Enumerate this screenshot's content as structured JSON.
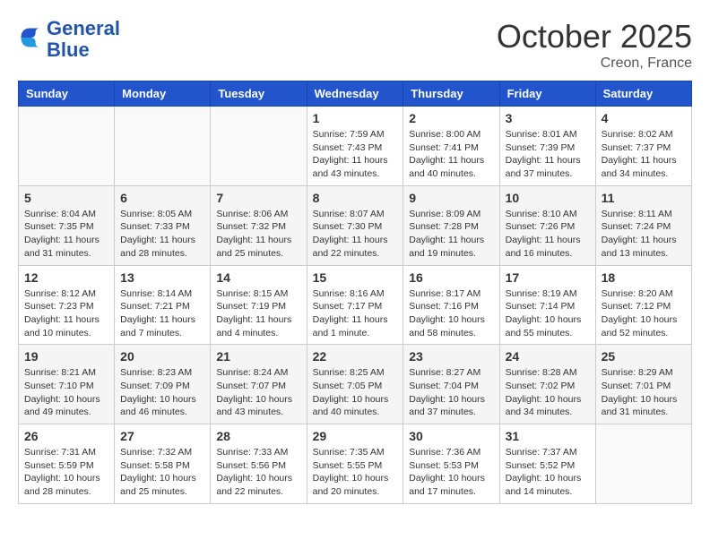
{
  "header": {
    "logo_line1": "General",
    "logo_line2": "Blue",
    "month": "October 2025",
    "location": "Creon, France"
  },
  "weekdays": [
    "Sunday",
    "Monday",
    "Tuesday",
    "Wednesday",
    "Thursday",
    "Friday",
    "Saturday"
  ],
  "weeks": [
    [
      {
        "day": "",
        "sunrise": "",
        "sunset": "",
        "daylight": ""
      },
      {
        "day": "",
        "sunrise": "",
        "sunset": "",
        "daylight": ""
      },
      {
        "day": "",
        "sunrise": "",
        "sunset": "",
        "daylight": ""
      },
      {
        "day": "1",
        "sunrise": "Sunrise: 7:59 AM",
        "sunset": "Sunset: 7:43 PM",
        "daylight": "Daylight: 11 hours and 43 minutes."
      },
      {
        "day": "2",
        "sunrise": "Sunrise: 8:00 AM",
        "sunset": "Sunset: 7:41 PM",
        "daylight": "Daylight: 11 hours and 40 minutes."
      },
      {
        "day": "3",
        "sunrise": "Sunrise: 8:01 AM",
        "sunset": "Sunset: 7:39 PM",
        "daylight": "Daylight: 11 hours and 37 minutes."
      },
      {
        "day": "4",
        "sunrise": "Sunrise: 8:02 AM",
        "sunset": "Sunset: 7:37 PM",
        "daylight": "Daylight: 11 hours and 34 minutes."
      }
    ],
    [
      {
        "day": "5",
        "sunrise": "Sunrise: 8:04 AM",
        "sunset": "Sunset: 7:35 PM",
        "daylight": "Daylight: 11 hours and 31 minutes."
      },
      {
        "day": "6",
        "sunrise": "Sunrise: 8:05 AM",
        "sunset": "Sunset: 7:33 PM",
        "daylight": "Daylight: 11 hours and 28 minutes."
      },
      {
        "day": "7",
        "sunrise": "Sunrise: 8:06 AM",
        "sunset": "Sunset: 7:32 PM",
        "daylight": "Daylight: 11 hours and 25 minutes."
      },
      {
        "day": "8",
        "sunrise": "Sunrise: 8:07 AM",
        "sunset": "Sunset: 7:30 PM",
        "daylight": "Daylight: 11 hours and 22 minutes."
      },
      {
        "day": "9",
        "sunrise": "Sunrise: 8:09 AM",
        "sunset": "Sunset: 7:28 PM",
        "daylight": "Daylight: 11 hours and 19 minutes."
      },
      {
        "day": "10",
        "sunrise": "Sunrise: 8:10 AM",
        "sunset": "Sunset: 7:26 PM",
        "daylight": "Daylight: 11 hours and 16 minutes."
      },
      {
        "day": "11",
        "sunrise": "Sunrise: 8:11 AM",
        "sunset": "Sunset: 7:24 PM",
        "daylight": "Daylight: 11 hours and 13 minutes."
      }
    ],
    [
      {
        "day": "12",
        "sunrise": "Sunrise: 8:12 AM",
        "sunset": "Sunset: 7:23 PM",
        "daylight": "Daylight: 11 hours and 10 minutes."
      },
      {
        "day": "13",
        "sunrise": "Sunrise: 8:14 AM",
        "sunset": "Sunset: 7:21 PM",
        "daylight": "Daylight: 11 hours and 7 minutes."
      },
      {
        "day": "14",
        "sunrise": "Sunrise: 8:15 AM",
        "sunset": "Sunset: 7:19 PM",
        "daylight": "Daylight: 11 hours and 4 minutes."
      },
      {
        "day": "15",
        "sunrise": "Sunrise: 8:16 AM",
        "sunset": "Sunset: 7:17 PM",
        "daylight": "Daylight: 11 hours and 1 minute."
      },
      {
        "day": "16",
        "sunrise": "Sunrise: 8:17 AM",
        "sunset": "Sunset: 7:16 PM",
        "daylight": "Daylight: 10 hours and 58 minutes."
      },
      {
        "day": "17",
        "sunrise": "Sunrise: 8:19 AM",
        "sunset": "Sunset: 7:14 PM",
        "daylight": "Daylight: 10 hours and 55 minutes."
      },
      {
        "day": "18",
        "sunrise": "Sunrise: 8:20 AM",
        "sunset": "Sunset: 7:12 PM",
        "daylight": "Daylight: 10 hours and 52 minutes."
      }
    ],
    [
      {
        "day": "19",
        "sunrise": "Sunrise: 8:21 AM",
        "sunset": "Sunset: 7:10 PM",
        "daylight": "Daylight: 10 hours and 49 minutes."
      },
      {
        "day": "20",
        "sunrise": "Sunrise: 8:23 AM",
        "sunset": "Sunset: 7:09 PM",
        "daylight": "Daylight: 10 hours and 46 minutes."
      },
      {
        "day": "21",
        "sunrise": "Sunrise: 8:24 AM",
        "sunset": "Sunset: 7:07 PM",
        "daylight": "Daylight: 10 hours and 43 minutes."
      },
      {
        "day": "22",
        "sunrise": "Sunrise: 8:25 AM",
        "sunset": "Sunset: 7:05 PM",
        "daylight": "Daylight: 10 hours and 40 minutes."
      },
      {
        "day": "23",
        "sunrise": "Sunrise: 8:27 AM",
        "sunset": "Sunset: 7:04 PM",
        "daylight": "Daylight: 10 hours and 37 minutes."
      },
      {
        "day": "24",
        "sunrise": "Sunrise: 8:28 AM",
        "sunset": "Sunset: 7:02 PM",
        "daylight": "Daylight: 10 hours and 34 minutes."
      },
      {
        "day": "25",
        "sunrise": "Sunrise: 8:29 AM",
        "sunset": "Sunset: 7:01 PM",
        "daylight": "Daylight: 10 hours and 31 minutes."
      }
    ],
    [
      {
        "day": "26",
        "sunrise": "Sunrise: 7:31 AM",
        "sunset": "Sunset: 5:59 PM",
        "daylight": "Daylight: 10 hours and 28 minutes."
      },
      {
        "day": "27",
        "sunrise": "Sunrise: 7:32 AM",
        "sunset": "Sunset: 5:58 PM",
        "daylight": "Daylight: 10 hours and 25 minutes."
      },
      {
        "day": "28",
        "sunrise": "Sunrise: 7:33 AM",
        "sunset": "Sunset: 5:56 PM",
        "daylight": "Daylight: 10 hours and 22 minutes."
      },
      {
        "day": "29",
        "sunrise": "Sunrise: 7:35 AM",
        "sunset": "Sunset: 5:55 PM",
        "daylight": "Daylight: 10 hours and 20 minutes."
      },
      {
        "day": "30",
        "sunrise": "Sunrise: 7:36 AM",
        "sunset": "Sunset: 5:53 PM",
        "daylight": "Daylight: 10 hours and 17 minutes."
      },
      {
        "day": "31",
        "sunrise": "Sunrise: 7:37 AM",
        "sunset": "Sunset: 5:52 PM",
        "daylight": "Daylight: 10 hours and 14 minutes."
      },
      {
        "day": "",
        "sunrise": "",
        "sunset": "",
        "daylight": ""
      }
    ]
  ]
}
